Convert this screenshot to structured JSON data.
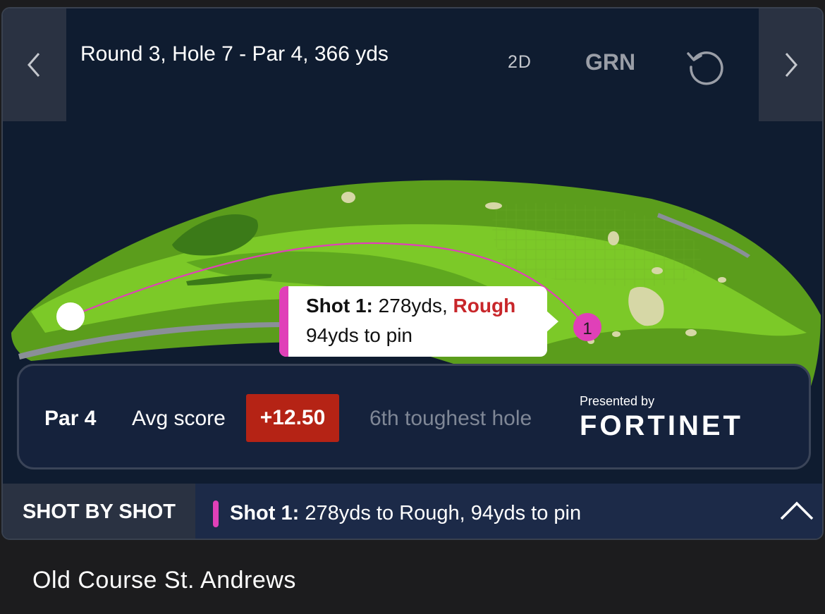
{
  "header": {
    "title": "Round 3, Hole 7 - Par 4, 366 yds",
    "view_2d_label": "2D",
    "view_grn_label": "GRN"
  },
  "map": {
    "ball_marker": "1",
    "shot_color": "#e040b8"
  },
  "tooltip": {
    "shot_label": "Shot 1:",
    "distance": "278yds,",
    "lie": "Rough",
    "to_pin": "94yds to pin",
    "lie_color": "#c8262a"
  },
  "stats": {
    "par_label": "Par 4",
    "avg_label": "Avg score",
    "avg_value": "+12.50",
    "toughness": "6th toughest hole",
    "sponsor_prefix": "Presented by",
    "sponsor_name": "FORTINET"
  },
  "shot_by_shot": {
    "label": "SHOT BY SHOT",
    "shot_label": "Shot 1:",
    "summary": "278yds to Rough, 94yds to pin"
  },
  "course_name": "Old Course St. Andrews",
  "icons": {
    "prev": "chevron-left-icon",
    "next": "chevron-right-icon",
    "reset": "reset-icon",
    "expand": "chevron-up-icon"
  }
}
